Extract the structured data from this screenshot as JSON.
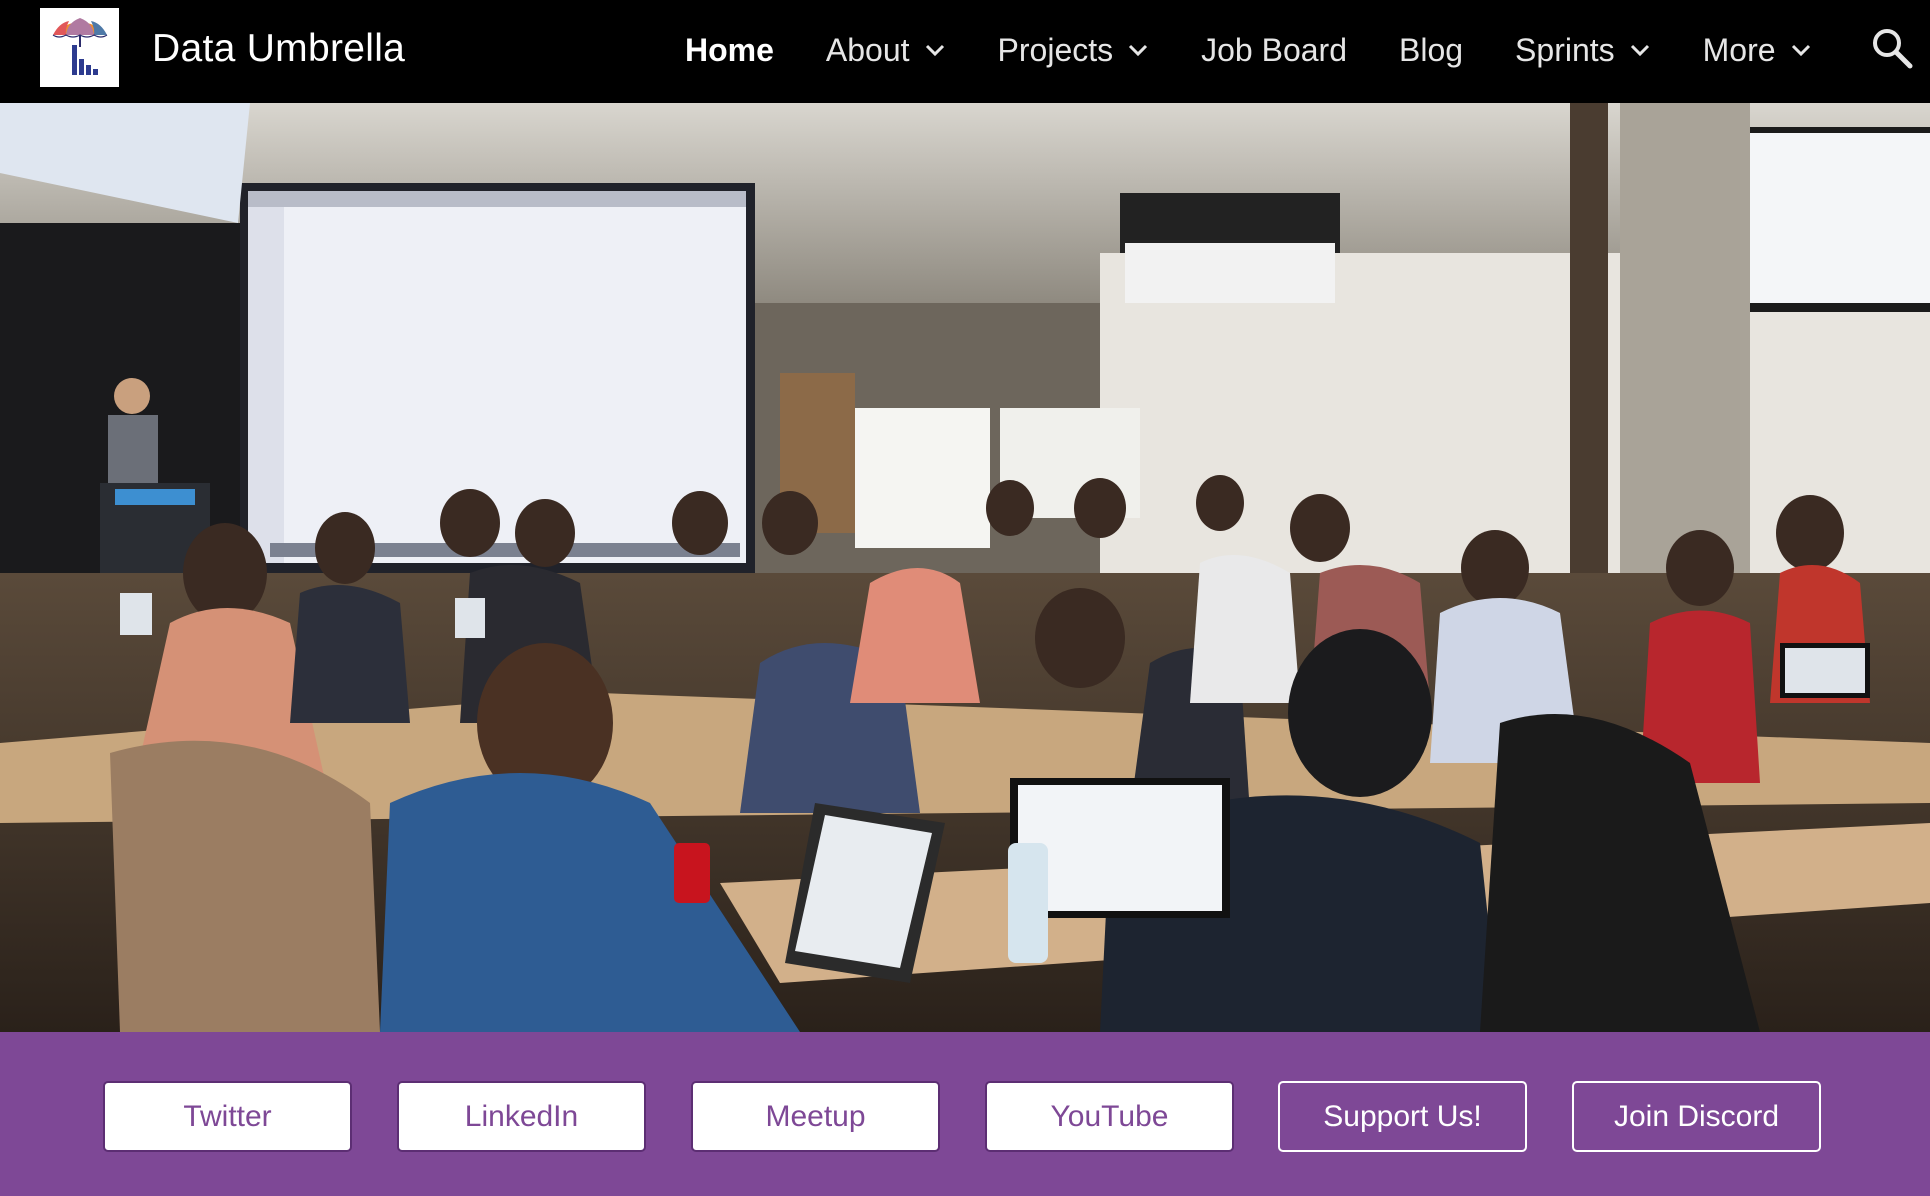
{
  "site": {
    "title": "Data Umbrella",
    "logo_icon": "umbrella-bar-chart-logo"
  },
  "nav": {
    "items": [
      {
        "label": "Home",
        "active": true,
        "dropdown": false
      },
      {
        "label": "About",
        "active": false,
        "dropdown": true
      },
      {
        "label": "Projects",
        "active": false,
        "dropdown": true
      },
      {
        "label": "Job Board",
        "active": false,
        "dropdown": false
      },
      {
        "label": "Blog",
        "active": false,
        "dropdown": false
      },
      {
        "label": "Sprints",
        "active": false,
        "dropdown": true
      },
      {
        "label": "More",
        "active": false,
        "dropdown": true
      }
    ],
    "search_icon": "search-icon"
  },
  "hero": {
    "image_icon": "photo-classroom-workshop"
  },
  "social": {
    "buttons": [
      {
        "label": "Twitter",
        "style": "light"
      },
      {
        "label": "LinkedIn",
        "style": "light"
      },
      {
        "label": "Meetup",
        "style": "light"
      },
      {
        "label": "YouTube",
        "style": "light"
      },
      {
        "label": "Support Us!",
        "style": "dark"
      },
      {
        "label": "Join Discord",
        "style": "dark"
      }
    ]
  },
  "colors": {
    "header_bg": "#000000",
    "brand_purple": "#7e4896",
    "text_light": "#ffffff"
  }
}
